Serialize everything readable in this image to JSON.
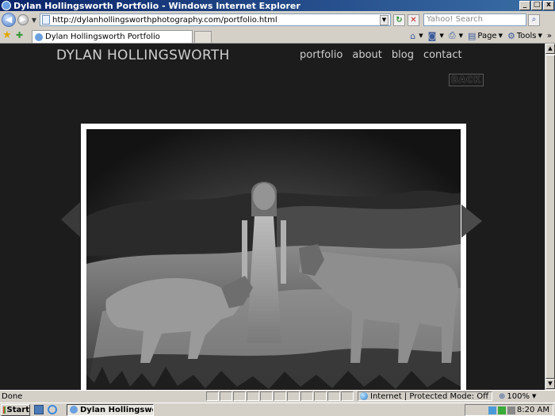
{
  "window": {
    "title": "Dylan Hollingsworth Portfolio - Windows Internet Explorer",
    "controls": {
      "minimize": "_",
      "maximize": "□",
      "close": "x"
    }
  },
  "address_bar": {
    "url": "http://dylanhollingsworthphotography.com/portfolio.html",
    "search_placeholder": "Yahoo! Search"
  },
  "tabs": [
    {
      "label": "Dylan Hollingsworth Portfolio",
      "active": true
    }
  ],
  "command_bar": {
    "page_label": "Page",
    "tools_label": "Tools",
    "more": "»"
  },
  "site": {
    "name": "DYLAN HOLLINGSWORTH",
    "nav": [
      {
        "label": "portfolio"
      },
      {
        "label": "about"
      },
      {
        "label": "blog"
      },
      {
        "label": "contact"
      }
    ],
    "back_label": "BACK",
    "colors": {
      "background": "#1c1c1c",
      "text": "#cfcfcf",
      "frame": "#ffffff"
    }
  },
  "status_bar": {
    "status": "Done",
    "zone": "Internet | Protected Mode: Off",
    "zoom": "100%"
  },
  "taskbar": {
    "start_label": "Start",
    "task_label": "Dylan Hollingsworth P...",
    "clock": "8:20 AM"
  },
  "icons": {
    "back": "back-arrow-icon",
    "forward": "forward-arrow-icon",
    "refresh": "refresh-icon",
    "stop": "stop-icon",
    "search": "search-icon",
    "favorites": "favorites-star-icon",
    "add_favorites": "add-favorites-icon",
    "home": "home-icon",
    "feeds": "rss-feed-icon",
    "print": "print-icon"
  }
}
